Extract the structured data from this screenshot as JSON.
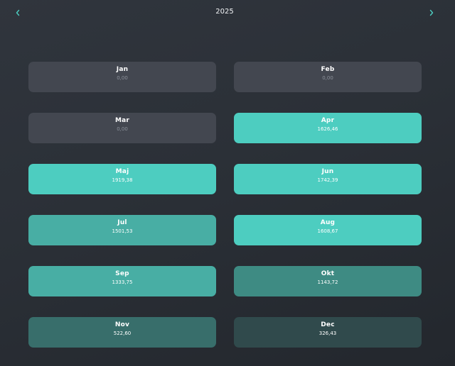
{
  "header": {
    "year": "2025",
    "prev_icon": "chevron-left-icon",
    "next_icon": "chevron-right-icon",
    "accent_color": "#4dcdc0"
  },
  "months": [
    {
      "name": "Jan",
      "amount": "0,00",
      "level": "empty"
    },
    {
      "name": "Feb",
      "amount": "0,00",
      "level": "empty"
    },
    {
      "name": "Mar",
      "amount": "0,00",
      "level": "empty"
    },
    {
      "name": "Apr",
      "amount": "1626,46",
      "level": "l4"
    },
    {
      "name": "Maj",
      "amount": "1919,38",
      "level": "l4"
    },
    {
      "name": "Jun",
      "amount": "1742,39",
      "level": "l4"
    },
    {
      "name": "Jul",
      "amount": "1501,53",
      "level": "l3"
    },
    {
      "name": "Aug",
      "amount": "1608,67",
      "level": "l4"
    },
    {
      "name": "Sep",
      "amount": "1333,75",
      "level": "l3"
    },
    {
      "name": "Okt",
      "amount": "1143,72",
      "level": "l2"
    },
    {
      "name": "Nov",
      "amount": "522,60",
      "level": "l1"
    },
    {
      "name": "Dec",
      "amount": "326,43",
      "level": "l0"
    }
  ]
}
